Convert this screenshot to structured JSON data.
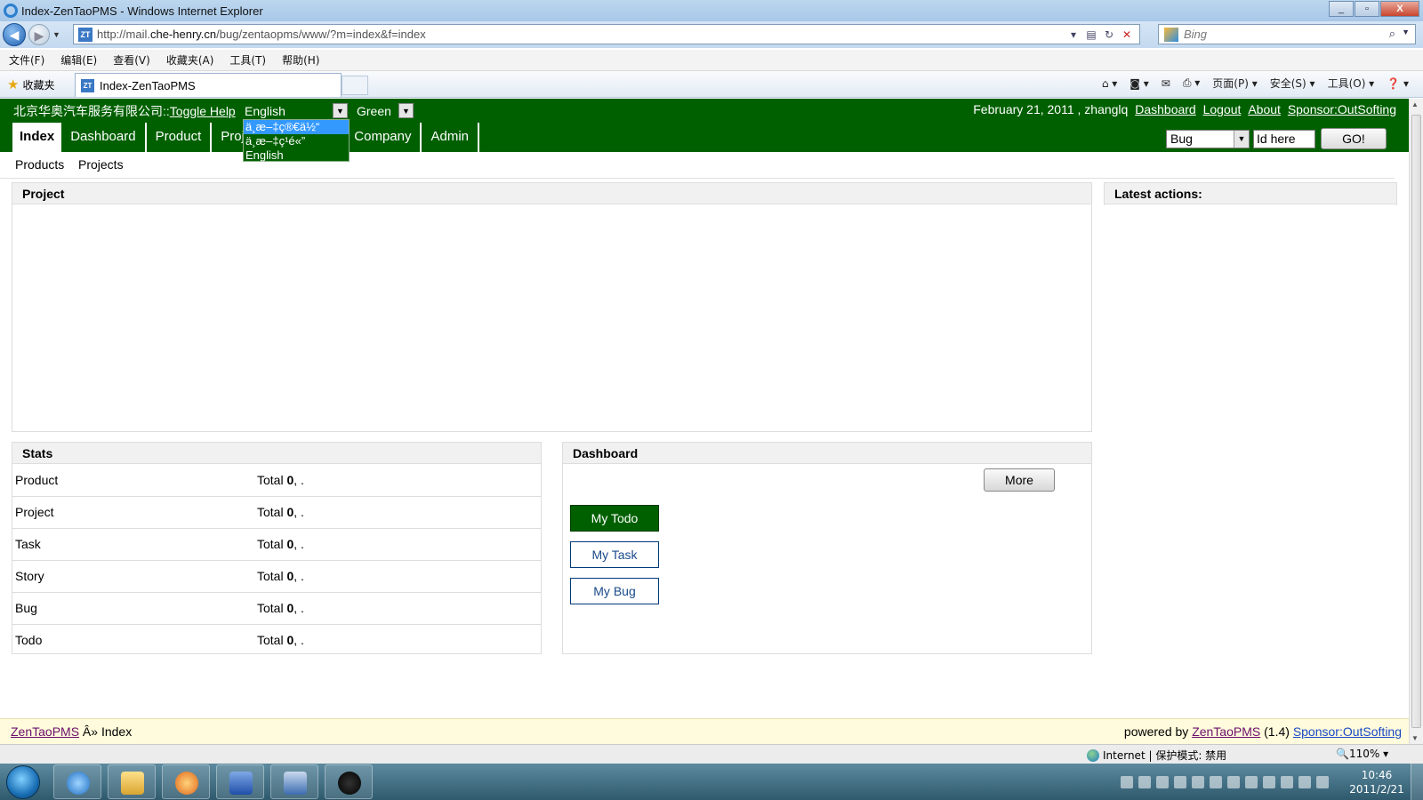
{
  "window": {
    "title": "Index-ZenTaoPMS - Windows Internet Explorer",
    "address": "http://mail.che-henry.cn/bug/zentaopms/www/?m=index&f=index",
    "address_prefix": "http://mail.",
    "address_domain": "che-henry.cn",
    "address_rest": "/bug/zentaopms/www/?m=index&f=index",
    "search_placeholder": "Bing",
    "tab_title": "Index-ZenTaoPMS",
    "favorites_label": "收藏夹",
    "minimize": "_",
    "maximize": "▫",
    "close": "X"
  },
  "menubar": [
    "文件(F)",
    "编辑(E)",
    "查看(V)",
    "收藏夹(A)",
    "工具(T)",
    "帮助(H)"
  ],
  "commandbar": [
    "页面(P) ▾",
    "安全(S) ▾",
    "工具(O) ▾"
  ],
  "topbar": {
    "company": "北京华奥汽车服务有限公司::",
    "toggle_help": "Toggle Help",
    "lang_selected": "English",
    "lang_options": [
      "ä¸­æ–‡ç®€ä½“",
      "ä¸­æ–‡ç¹é«”",
      "English"
    ],
    "theme_selected": "Green",
    "date_user": "February 21, 2011 , zhanglq",
    "links": [
      "Dashboard",
      "Logout",
      "About",
      "Sponsor:OutSofting"
    ]
  },
  "mainnav": [
    "Index",
    "Dashboard",
    "Product",
    "Proj",
    "Company",
    "Admin"
  ],
  "search": {
    "type": "Bug",
    "id_placeholder": "Id here",
    "go": "GO!"
  },
  "subnav": [
    "Products",
    "Projects"
  ],
  "panels": {
    "project_title": "Project",
    "latest_title": "Latest actions:",
    "stats_title": "Stats",
    "dashboard_title": "Dashboard"
  },
  "stats": [
    {
      "label": "Product",
      "prefix": "Total ",
      "count": "0",
      "suffix": ", ."
    },
    {
      "label": "Project",
      "prefix": "Total ",
      "count": "0",
      "suffix": ", ."
    },
    {
      "label": "Task",
      "prefix": "Total ",
      "count": "0",
      "suffix": ", ."
    },
    {
      "label": "Story",
      "prefix": "Total ",
      "count": "0",
      "suffix": ", ."
    },
    {
      "label": "Bug",
      "prefix": "Total ",
      "count": "0",
      "suffix": ", ."
    },
    {
      "label": "Todo",
      "prefix": "Total ",
      "count": "0",
      "suffix": ", ."
    }
  ],
  "dashboard": {
    "more": "More",
    "buttons": [
      "My Todo",
      "My Task",
      "My Bug"
    ]
  },
  "footer": {
    "brand": "ZenTaoPMS",
    "crumb": " Â» Index",
    "powered": "powered by ",
    "version": " (1.4) ",
    "sponsor": "Sponsor:OutSofting"
  },
  "statusbar": {
    "zone": "Internet | 保护模式: 禁用",
    "zoom": "110%"
  },
  "clock": {
    "time": "10:46",
    "date": "2011/2/21"
  },
  "colors": {
    "theme_green": "#006000",
    "highlight": "#3399ff",
    "footer_bg": "#fffbdc"
  }
}
